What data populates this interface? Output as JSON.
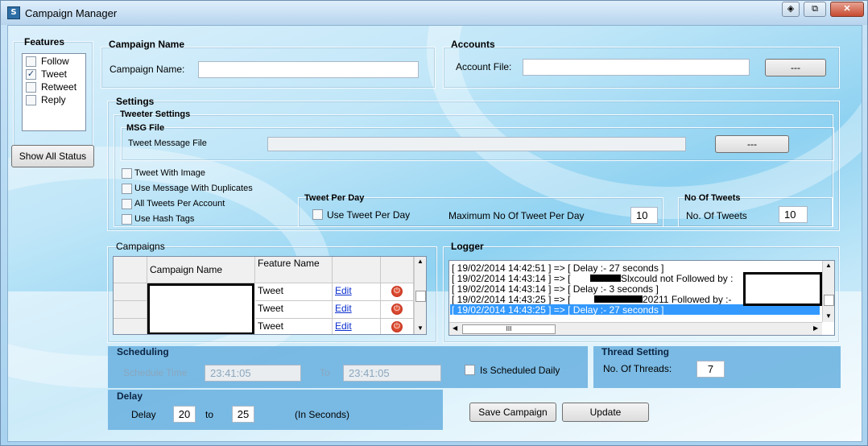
{
  "window": {
    "title": "Campaign Manager",
    "app_icon": "app-icon"
  },
  "features": {
    "legend": "Features",
    "items": [
      {
        "label": "Follow",
        "checked": false
      },
      {
        "label": "Tweet",
        "checked": true
      },
      {
        "label": "Retweet",
        "checked": false
      },
      {
        "label": "Reply",
        "checked": false
      }
    ],
    "show_all_status": "Show All Status"
  },
  "campaign_name": {
    "legend": "Campaign Name",
    "label": "Campaign Name:",
    "value": ""
  },
  "accounts": {
    "legend": "Accounts",
    "label": "Account File:",
    "value": "",
    "browse": "---"
  },
  "settings": {
    "legend": "Settings",
    "tweeter_settings": "Tweeter Settings",
    "msg_file": {
      "legend": "MSG File",
      "label": "Tweet Message File",
      "value": "",
      "browse": "---"
    },
    "options": [
      {
        "label": "Tweet With Image",
        "checked": false
      },
      {
        "label": "Use Message With Duplicates",
        "checked": false
      },
      {
        "label": "All Tweets Per Account",
        "checked": false
      },
      {
        "label": "Use Hash Tags",
        "checked": false
      }
    ],
    "tweet_per_day": {
      "legend": "Tweet Per Day",
      "checkbox_label": "Use Tweet Per Day",
      "checked": false,
      "max_label": "Maximum No Of Tweet Per Day",
      "max_value": "10"
    },
    "no_of_tweets": {
      "legend": "No Of Tweets",
      "label": "No. Of Tweets",
      "value": "10"
    }
  },
  "campaigns": {
    "legend": "Campaigns",
    "columns": [
      "Campaign Name",
      "Feature Name"
    ],
    "rows": [
      {
        "feature": "Tweet",
        "action": "Edit"
      },
      {
        "feature": "Tweet",
        "action": "Edit"
      },
      {
        "feature": "Tweet",
        "action": "Edit"
      }
    ]
  },
  "logger": {
    "legend": "Logger",
    "lines": [
      "[ 19/02/2014 14:42:51 ] => [ Delay :- 27 seconds ]",
      "[ 19/02/2014 14:43:14 ] => [",
      "[ 19/02/2014 14:43:14 ] => [ Delay :- 3 seconds ]",
      "[ 19/02/2014 14:43:25 ] => [",
      "[ 19/02/2014 14:43:25 ] => [ Delay :- 27 seconds ]"
    ],
    "line2_suffix": "Slxcould not Followed by :",
    "line4_suffix": "20211 Followed by :-",
    "selected_index": 4,
    "hscroll_grip": "III"
  },
  "scheduling": {
    "legend": "Scheduling",
    "schedule_time_label": "Schedule Time",
    "time_from": "23:41:05",
    "to_label": "To",
    "time_to": "23:41:05",
    "daily_label": "Is Scheduled Daily",
    "daily_checked": false
  },
  "thread_setting": {
    "legend": "Thread Setting",
    "label": "No. Of Threads:",
    "value": "7"
  },
  "delay": {
    "legend": "Delay",
    "label": "Delay",
    "from": "20",
    "to_label": "to",
    "to": "25",
    "unit": "(In Seconds)"
  },
  "actions": {
    "save": "Save Campaign",
    "update": "Update"
  }
}
